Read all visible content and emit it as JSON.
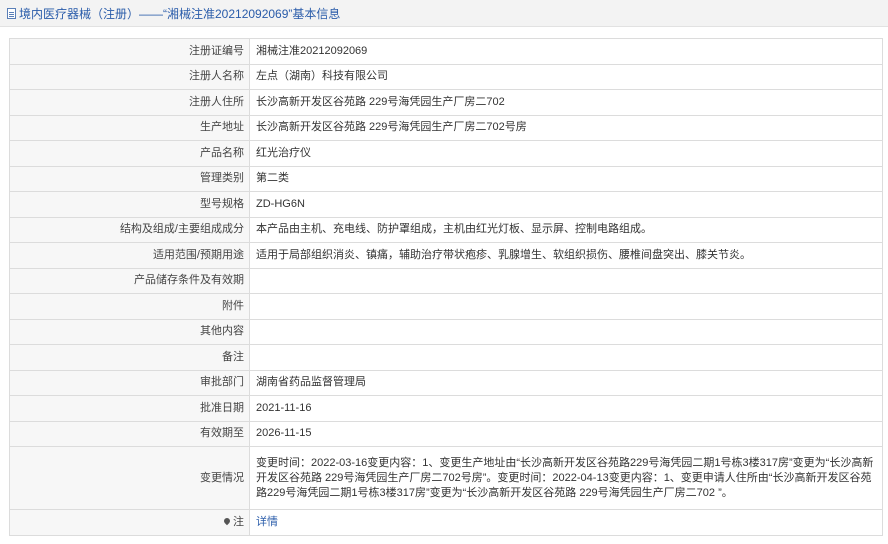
{
  "header": {
    "icon": "document-icon",
    "title": "境内医疗器械（注册）——“湘械注准20212092069”基本信息"
  },
  "rows": [
    {
      "label": "注册证编号",
      "value": "湘械注准20212092069"
    },
    {
      "label": "注册人名称",
      "value": "左点（湖南）科技有限公司"
    },
    {
      "label": "注册人住所",
      "value": "长沙高新开发区谷苑路 229号海凭园生产厂房二702"
    },
    {
      "label": "生产地址",
      "value": "长沙高新开发区谷苑路 229号海凭园生产厂房二702号房"
    },
    {
      "label": "产品名称",
      "value": "红光治疗仪"
    },
    {
      "label": "管理类别",
      "value": "第二类"
    },
    {
      "label": "型号规格",
      "value": "ZD-HG6N"
    },
    {
      "label": "结构及组成/主要组成成分",
      "value": "本产品由主机、充电线、防护罩组成，主机由红光灯板、显示屏、控制电路组成。"
    },
    {
      "label": "适用范围/预期用途",
      "value": "适用于局部组织消炎、镇痛，辅助治疗带状疱疹、乳腺增生、软组织损伤、腰椎间盘突出、膝关节炎。"
    },
    {
      "label": "产品储存条件及有效期",
      "value": ""
    },
    {
      "label": "附件",
      "value": ""
    },
    {
      "label": "其他内容",
      "value": ""
    },
    {
      "label": "备注",
      "value": ""
    },
    {
      "label": "审批部门",
      "value": "湖南省药品监督管理局"
    },
    {
      "label": "批准日期",
      "value": "2021-11-16"
    },
    {
      "label": "有效期至",
      "value": "2026-11-15"
    },
    {
      "label": "变更情况",
      "value": "变更时间：2022-03-16变更内容：1、变更生产地址由“长沙高新开发区谷苑路229号海凭园二期1号栋3楼317房”变更为“长沙高新开发区谷苑路 229号海凭园生产厂房二702号房”。变更时间：2022-04-13变更内容：1、变更申请人住所由“长沙高新开发区谷苑路229号海凭园二期1号栋3楼317房”变更为“长沙高新开发区谷苑路 229号海凭园生产厂房二702 ”。"
    }
  ],
  "note": {
    "icon": "pin-icon",
    "label": "注",
    "link_text": "详情"
  }
}
